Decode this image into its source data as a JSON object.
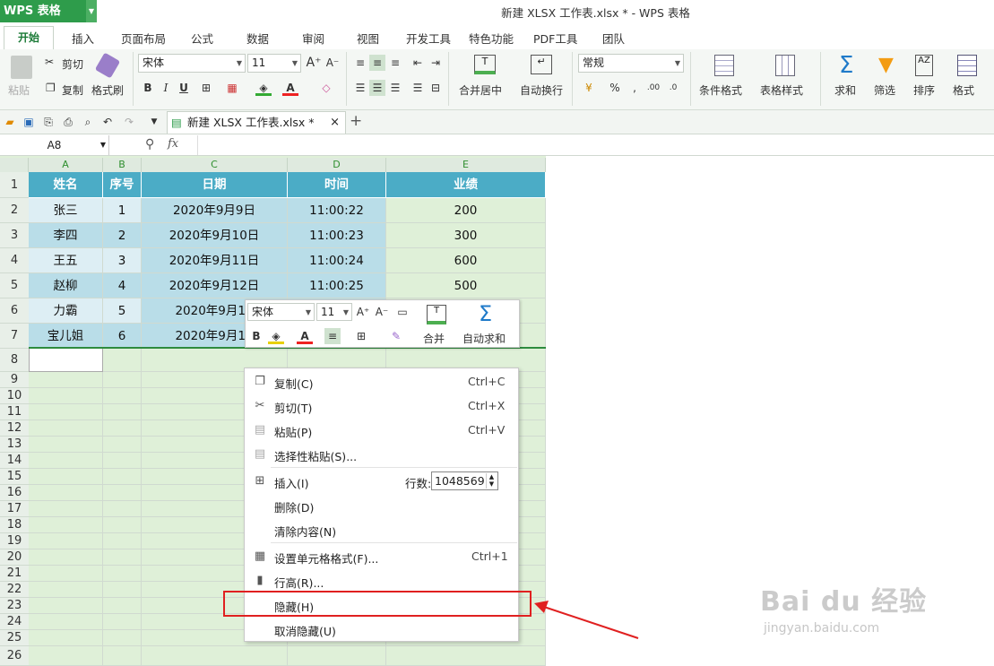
{
  "app": {
    "logo": "WPS 表格",
    "title": "新建 XLSX 工作表.xlsx * - WPS 表格"
  },
  "tabs": [
    "开始",
    "插入",
    "页面布局",
    "公式",
    "数据",
    "审阅",
    "视图",
    "开发工具",
    "特色功能",
    "PDF工具",
    "团队"
  ],
  "ribbon": {
    "paste": "粘贴",
    "cut": "剪切",
    "copy": "复制",
    "format_painter": "格式刷",
    "font": "宋体",
    "size": "11",
    "merge": "合并居中",
    "wrap": "自动换行",
    "number_format": "常规",
    "cond_format": "条件格式",
    "table_style": "表格样式",
    "sum": "求和",
    "filter": "筛选",
    "sort": "排序",
    "format": "格式",
    "bold": "B",
    "italic": "I",
    "underline": "U",
    "percent": "%"
  },
  "doc_tab": "新建 XLSX 工作表.xlsx *",
  "name_box": "A8",
  "fx": "fx",
  "columns": [
    "A",
    "B",
    "C",
    "D",
    "E"
  ],
  "rows": [
    "1",
    "2",
    "3",
    "4",
    "5",
    "6",
    "7",
    "8",
    "9",
    "10",
    "11",
    "12",
    "13",
    "14",
    "15",
    "16",
    "17",
    "18",
    "19",
    "20",
    "21",
    "22",
    "23",
    "24",
    "25",
    "26"
  ],
  "table": {
    "headers": [
      "姓名",
      "序号",
      "日期",
      "时间",
      "业绩"
    ],
    "data": [
      [
        "张三",
        "1",
        "2020年9月9日",
        "11:00:22",
        "200"
      ],
      [
        "李四",
        "2",
        "2020年9月10日",
        "11:00:23",
        "300"
      ],
      [
        "王五",
        "3",
        "2020年9月11日",
        "11:00:24",
        "600"
      ],
      [
        "赵柳",
        "4",
        "2020年9月12日",
        "11:00:25",
        "500"
      ],
      [
        "力霸",
        "5",
        "2020年9月13",
        "",
        " "
      ],
      [
        "宝儿姐",
        "6",
        "2020年9月14",
        "",
        ""
      ]
    ]
  },
  "mini_toolbar": {
    "font": "宋体",
    "size": "11",
    "merge": "合并",
    "autosum": "自动求和"
  },
  "context_menu": {
    "copy": "复制(C)",
    "copy_sc": "Ctrl+C",
    "cut": "剪切(T)",
    "cut_sc": "Ctrl+X",
    "paste": "粘贴(P)",
    "paste_sc": "Ctrl+V",
    "paste_special": "选择性粘贴(S)...",
    "insert": "插入(I)",
    "rows_label": "行数:",
    "rows_value": "1048569",
    "delete": "删除(D)",
    "clear": "清除内容(N)",
    "format_cells": "设置单元格格式(F)...",
    "format_sc": "Ctrl+1",
    "row_height": "行高(R)...",
    "hide": "隐藏(H)",
    "unhide": "取消隐藏(U)"
  },
  "watermark": {
    "brand": "Bai du 经验",
    "url": "jingyan.baidu.com"
  }
}
